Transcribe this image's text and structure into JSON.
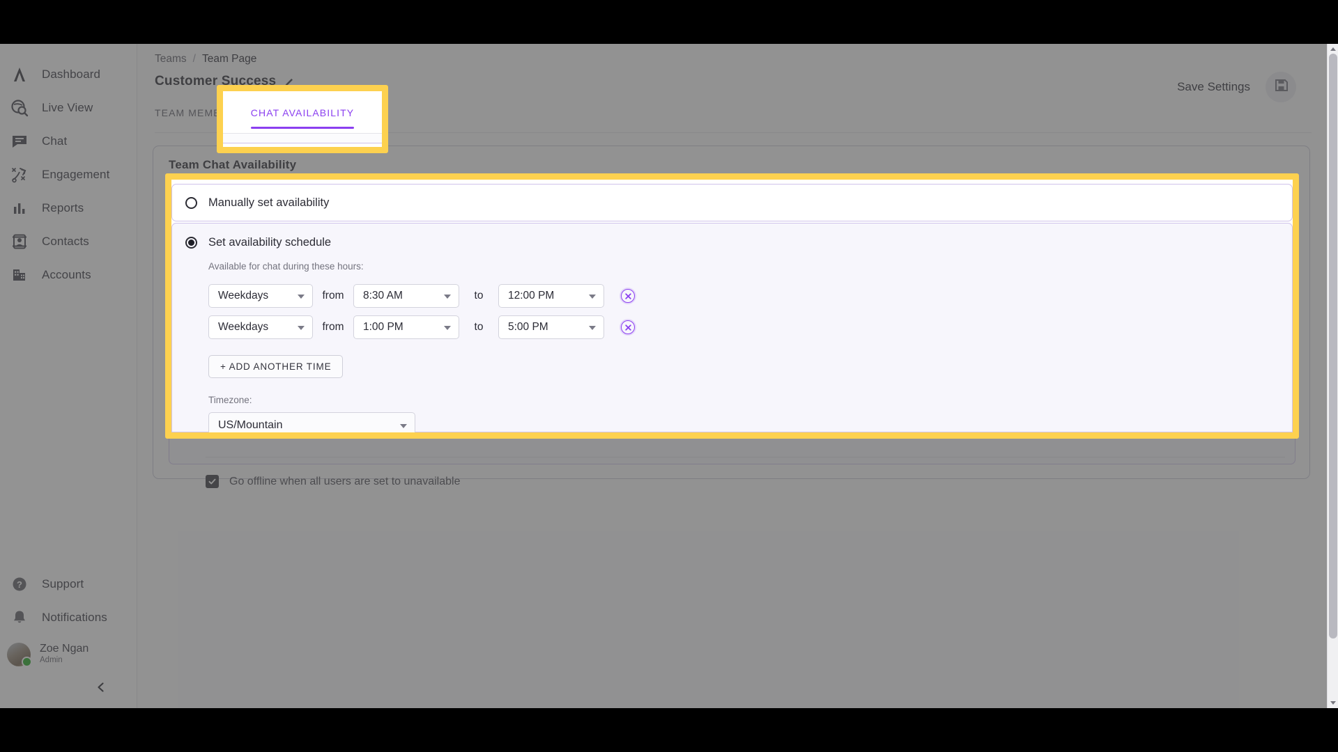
{
  "sidebar": {
    "nav_items": [
      {
        "label": "Dashboard",
        "icon": "logo-lambda-icon"
      },
      {
        "label": "Live View",
        "icon": "live-view-icon"
      },
      {
        "label": "Chat",
        "icon": "chat-bubble-icon"
      },
      {
        "label": "Engagement",
        "icon": "engagement-strategy-icon"
      },
      {
        "label": "Reports",
        "icon": "bar-chart-icon"
      },
      {
        "label": "Contacts",
        "icon": "contact-card-icon"
      },
      {
        "label": "Accounts",
        "icon": "building-icon"
      }
    ],
    "bottom_items": [
      {
        "label": "Support",
        "icon": "help-circle-icon"
      },
      {
        "label": "Notifications",
        "icon": "bell-icon"
      }
    ],
    "user": {
      "name": "Zoe Ngan",
      "role": "Admin",
      "status_color": "#18a718"
    },
    "collapse_icon": "chevron-left-icon"
  },
  "header": {
    "breadcrumb": {
      "parent": "Teams",
      "separator": "/",
      "current": "Team Page"
    },
    "team_name": "Customer Success",
    "edit_icon": "pencil-icon",
    "save_label": "Save Settings",
    "save_icon": "floppy-disk-save-icon"
  },
  "tabs": [
    {
      "label": "TEAM MEMBERS",
      "active": false
    },
    {
      "label": "CHAT AVAILABILITY",
      "active": true
    }
  ],
  "panel": {
    "title": "Team Chat Availability",
    "manual_option": {
      "label": "Manually set availability",
      "selected": false
    },
    "schedule_option": {
      "label": "Set availability schedule",
      "selected": true,
      "hint": "Available for chat during these hours:",
      "from_label": "from",
      "to_label": "to",
      "rows": [
        {
          "days": "Weekdays",
          "from": "8:30 AM",
          "to": "12:00 PM",
          "remove_icon": "remove-circle-x-icon"
        },
        {
          "days": "Weekdays",
          "from": "1:00 PM",
          "to": "5:00 PM",
          "remove_icon": "remove-circle-x-icon"
        }
      ],
      "add_button": "+ ADD ANOTHER TIME",
      "timezone_label": "Timezone:",
      "timezone_value": "US/Mountain",
      "offline_checkbox": {
        "label": "Go offline when all users are set to unavailable",
        "checked": true
      }
    }
  },
  "colors": {
    "accent_purple": "#8b3ff0",
    "highlight_yellow": "#fdd14f",
    "option_border": "#cfc2ea",
    "status_green": "#18a718"
  }
}
